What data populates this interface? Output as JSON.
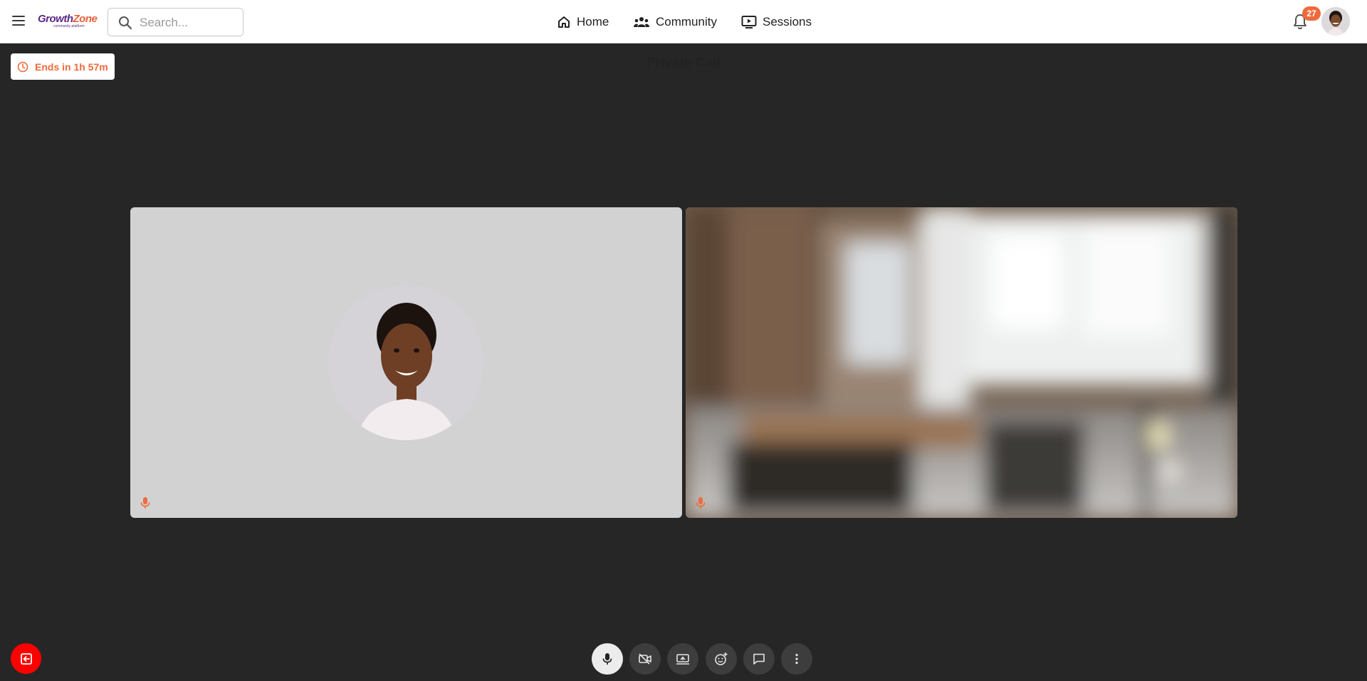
{
  "brand": {
    "name_part1": "Growth",
    "name_part2": "Zone",
    "tagline": "community platform",
    "primary_color": "#5b2a86",
    "accent_color": "#e8603c"
  },
  "search": {
    "placeholder": "Search..."
  },
  "nav": [
    {
      "label": "Home",
      "icon": "home-icon"
    },
    {
      "label": "Community",
      "icon": "people-icon"
    },
    {
      "label": "Sessions",
      "icon": "play-screen-icon"
    }
  ],
  "notifications": {
    "count": "27"
  },
  "call": {
    "timer_label": "Ends in 1h 57m",
    "title": "Private Call",
    "participants": [
      {
        "tile": "avatar",
        "mic_icon": "microphone-icon"
      },
      {
        "tile": "video",
        "mic_icon": "microphone-icon"
      }
    ]
  },
  "controls": [
    {
      "name": "microphone",
      "icon": "microphone-icon",
      "active": true
    },
    {
      "name": "camera-off",
      "icon": "camera-off-icon",
      "active": false
    },
    {
      "name": "share-screen",
      "icon": "screen-share-icon",
      "active": false
    },
    {
      "name": "reactions",
      "icon": "emoji-add-icon",
      "active": false
    },
    {
      "name": "chat",
      "icon": "chat-icon",
      "active": false
    },
    {
      "name": "more",
      "icon": "more-vertical-icon",
      "active": false
    }
  ],
  "colors": {
    "background": "#262626",
    "leave_button": "#ff0000",
    "timer_text": "#ef6a3c",
    "mic_indicator": "#ef6a3c"
  }
}
